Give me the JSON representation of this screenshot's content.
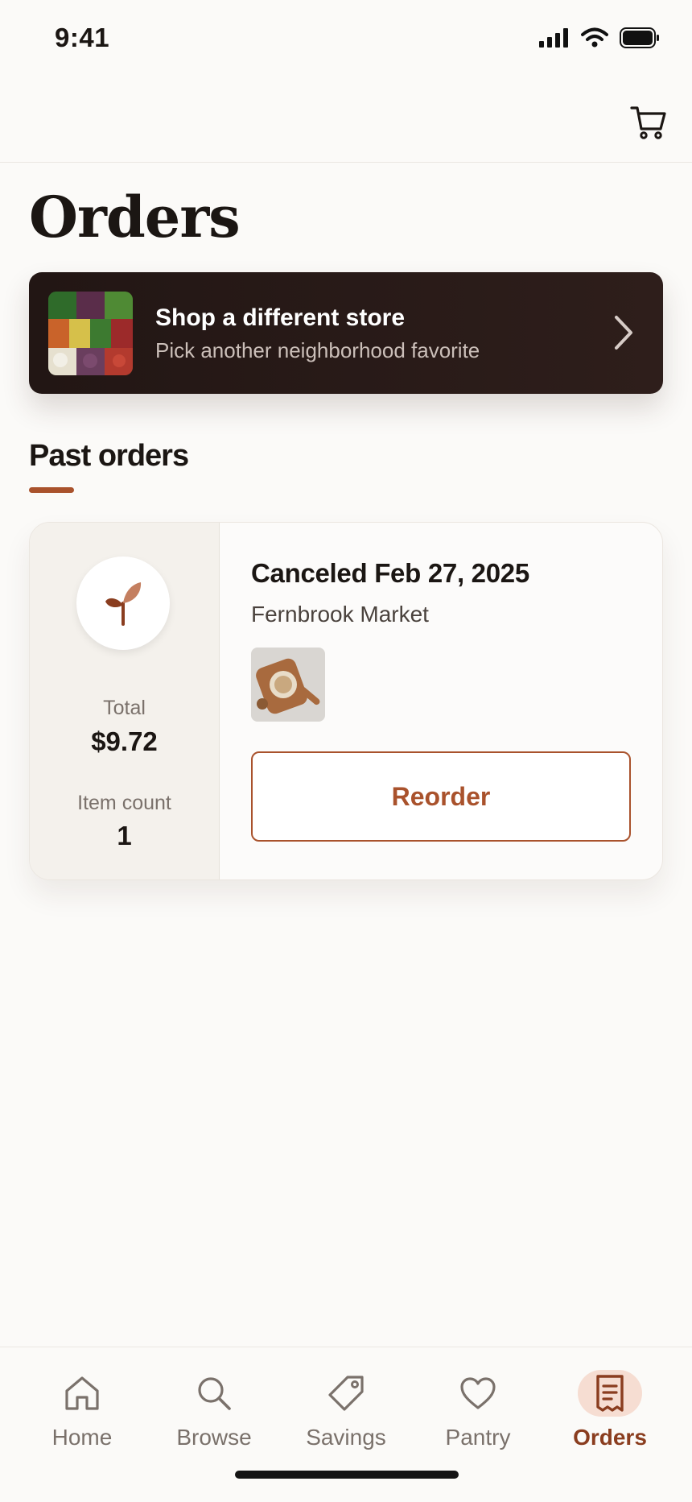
{
  "status_bar": {
    "time": "9:41"
  },
  "page": {
    "title": "Orders"
  },
  "store_banner": {
    "title": "Shop a different store",
    "subtitle": "Pick another neighborhood favorite"
  },
  "past_orders": {
    "section_title": "Past orders",
    "orders": [
      {
        "status": "Canceled Feb 27, 2025",
        "store": "Fernbrook Market",
        "total_label": "Total",
        "total": "$9.72",
        "count_label": "Item count",
        "count": "1",
        "reorder_label": "Reorder"
      }
    ]
  },
  "tab_bar": {
    "tabs": [
      {
        "label": "Home",
        "icon": "home-icon"
      },
      {
        "label": "Browse",
        "icon": "search-icon"
      },
      {
        "label": "Savings",
        "icon": "tag-icon"
      },
      {
        "label": "Pantry",
        "icon": "heart-icon"
      },
      {
        "label": "Orders",
        "icon": "receipt-icon",
        "active": true
      }
    ]
  },
  "colors": {
    "accent": "#a9522c",
    "banner_bg": "#261917",
    "active_tab_bg": "#f6ddd2",
    "page_bg": "#fbfaf8"
  }
}
